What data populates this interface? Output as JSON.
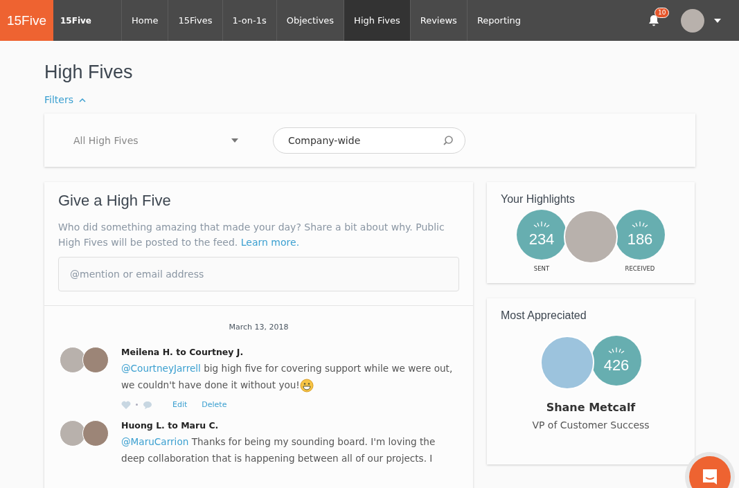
{
  "nav": {
    "logo": "15Five",
    "company": "15Five",
    "tabs": [
      {
        "label": "Home",
        "selected": false
      },
      {
        "label": "15Fives",
        "selected": false
      },
      {
        "label": "1-on-1s",
        "selected": false
      },
      {
        "label": "Objectives",
        "selected": false
      },
      {
        "label": "High Fives",
        "selected": true
      },
      {
        "label": "Reviews",
        "selected": false
      },
      {
        "label": "Reporting",
        "selected": false
      }
    ],
    "notifications": "10"
  },
  "page_title": "High Fives",
  "filters": {
    "label": "Filters",
    "expanded": true,
    "dropdown": "All High Fives",
    "search": {
      "value": "Company-wide"
    }
  },
  "give": {
    "title": "Give a High Five",
    "description": "Who did something amazing that made your day? Share a bit about why. Public High Fives will be posted to the feed.",
    "link": "Learn more.",
    "input": {
      "placeholder": "@mention or email address"
    }
  },
  "feed": {
    "date": "March 13, 2018",
    "posts": [
      {
        "header": "Meilena H. to Courtney J.",
        "mention": "@CourtneyJarrell",
        "text": "big high five for covering support while we were out, we couldn't have done it without you!",
        "emoji": true,
        "actions": [
          "Edit",
          "Delete"
        ]
      },
      {
        "header": "Huong L. to Maru C.",
        "mention": "@MaruCarrion",
        "text": "Thanks for being my sounding board. I'm loving the deep collaboration that is happening between all of our projects. I",
        "emoji": false
      }
    ]
  },
  "highlights": {
    "title": "Your Highlights",
    "sent": "234",
    "sent_label": "SENT",
    "received": "186",
    "received_label": "RECEIVED"
  },
  "most_appreciated": {
    "title": "Most Appreciated",
    "count": "426",
    "name": "Shane Metcalf",
    "role": "VP of Customer Success"
  }
}
